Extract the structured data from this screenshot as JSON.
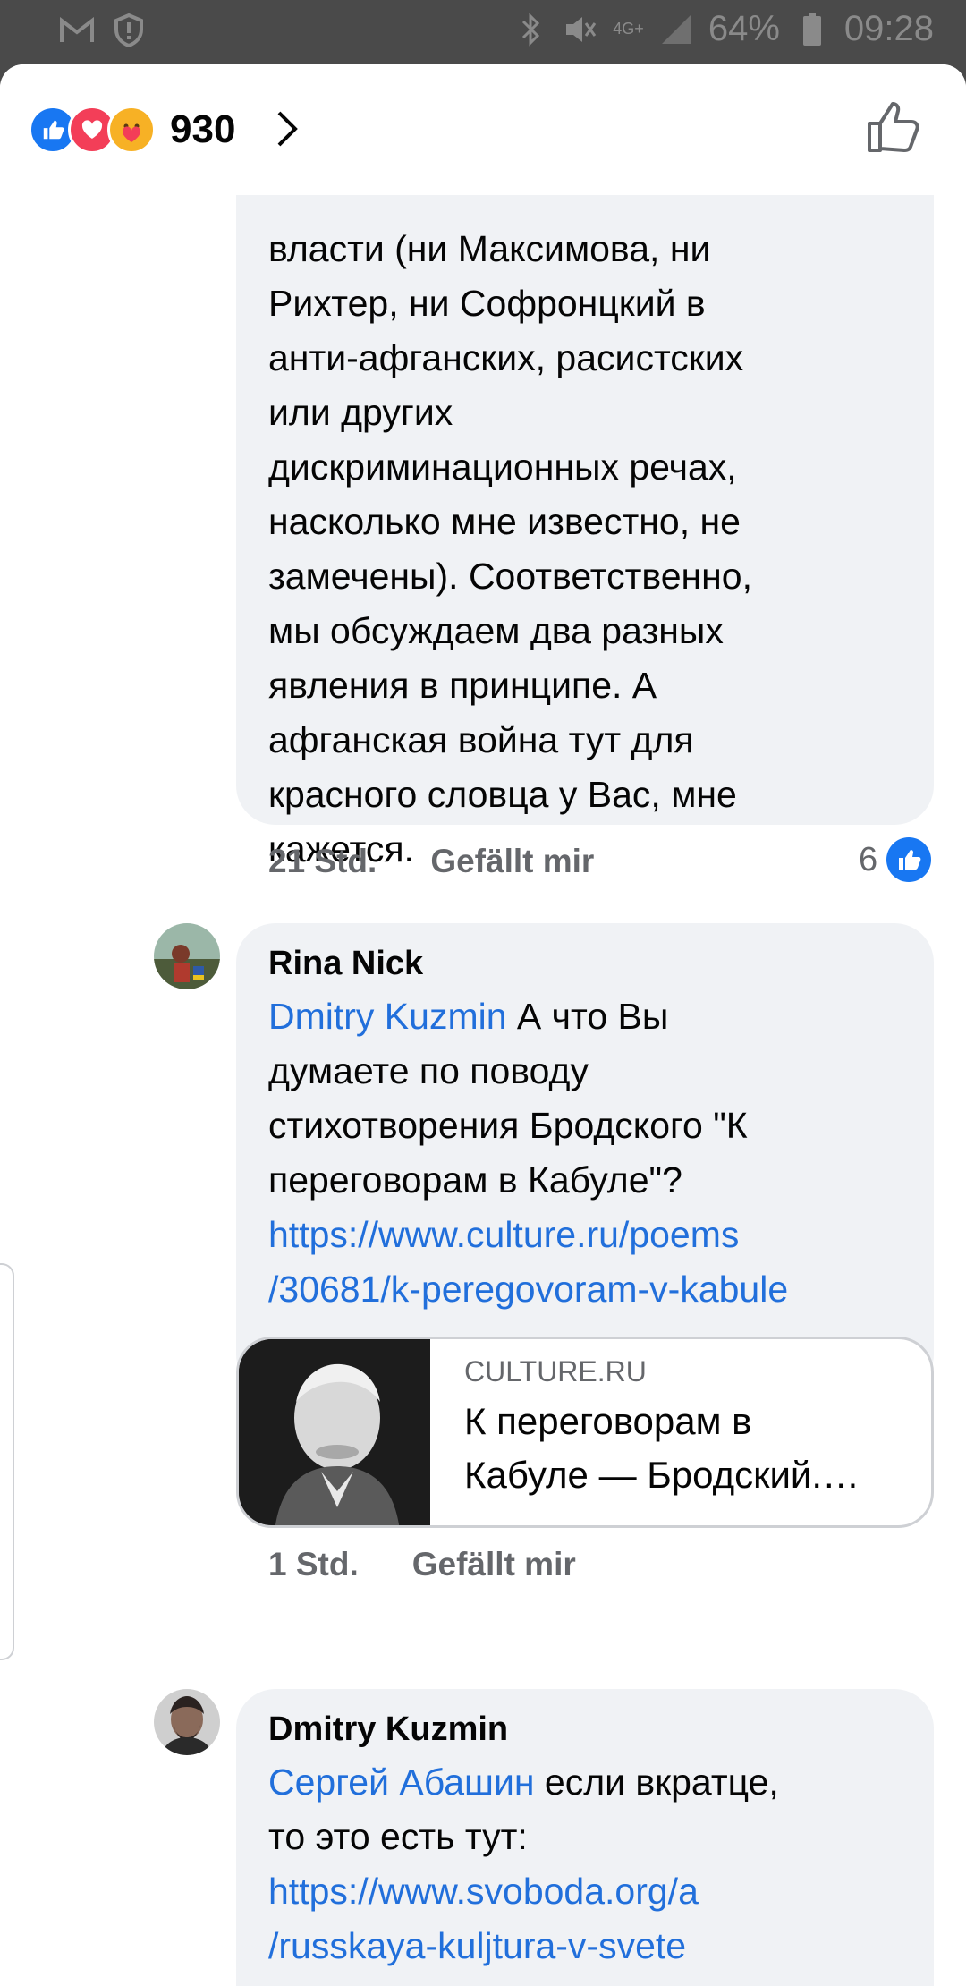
{
  "status_bar": {
    "battery": "64%",
    "time": "09:28",
    "network": "4G+"
  },
  "header": {
    "reaction_count": "930",
    "reaction_icons": [
      "like-icon",
      "love-icon",
      "care-icon"
    ],
    "colors": {
      "like": "#1877f2",
      "love": "#f33e58",
      "care": "#f7b125"
    }
  },
  "comment_top": {
    "text": "власти (ни Максимова, ни\nРихтер, ни Софронцкий в\nанти-афганских, расистских\nили других\nдискриминационных речах,\nнасколько мне известно, не\nзамечены). Соответственно,\nмы обсуждаем два разных\nявления в принципе. А\nафганская война тут для\nкрасного словца у Вас, мне\nкажется.",
    "time": "21 Std.",
    "like_label": "Gefällt mir",
    "like_count": "6"
  },
  "comment_rina": {
    "author": "Rina Nick",
    "mention": "Dmitry Kuzmin",
    "text": " А что Вы\nдумаете по поводу\nстихотворения Бродского \"К\nпереговорам в Кабуле\"?\n",
    "link": "https://www.culture.ru/poems\n/30681/k-peregovoram-v-kabule",
    "preview_domain": "CULTURE.RU",
    "preview_title": "К переговорам в\nКабуле — Бродский.…",
    "time": "1 Std.",
    "like_label": "Gefällt mir"
  },
  "comment_dmitry": {
    "author": "Dmitry Kuzmin",
    "mention": "Сергей Абашин",
    "text": " если вкратце,\nто это есть тут:\n",
    "link": "https://www.svoboda.org/a\n/russkaya-kuljtura-v-svete\n-bezhentsev-iz-mariupolya"
  }
}
